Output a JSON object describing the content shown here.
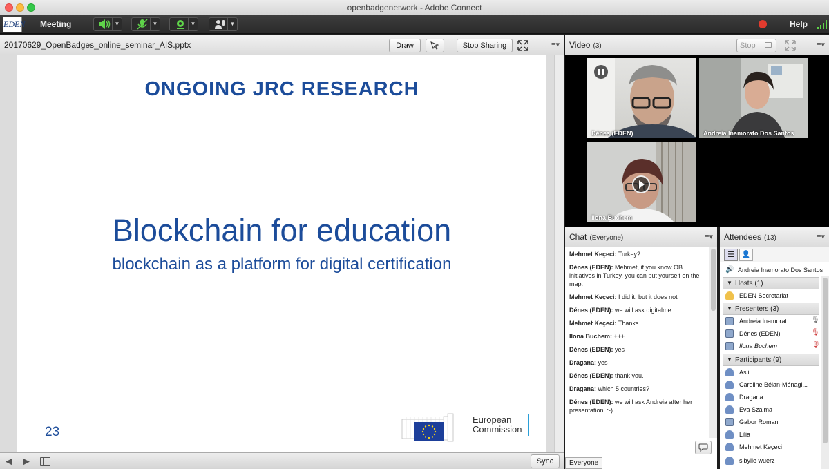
{
  "window": {
    "title": "openbadgenetwork - Adobe Connect"
  },
  "menubar": {
    "logo_text": "EDEN",
    "meeting_label": "Meeting",
    "help_label": "Help"
  },
  "share_pod": {
    "filename": "20170629_OpenBadges_online_seminar_AIS.pptx",
    "draw_label": "Draw",
    "stop_sharing_label": "Stop Sharing",
    "sync_label": "Sync"
  },
  "slide": {
    "heading": "ONGOING JRC RESEARCH",
    "title": "Blockchain for education",
    "subtitle": "blockchain as a platform for digital certification",
    "page_number": "23",
    "logo_line1": "European",
    "logo_line2": "Commission"
  },
  "video_pod": {
    "title": "Video",
    "count": "(3)",
    "stop_label": "Stop",
    "tiles": [
      {
        "name": "Dénes (EDEN)"
      },
      {
        "name": "Andreia Inamorato Dos Santos"
      },
      {
        "name": "Ilona Buchem"
      }
    ]
  },
  "chat_pod": {
    "title": "Chat",
    "scope": "(Everyone)",
    "recipient_label": "Everyone",
    "messages": [
      {
        "sender": "Mehmet Keçeci:",
        "text": " Turkey?"
      },
      {
        "sender": "Dénes (EDEN):",
        "text": " Mehmet, if you know OB initiatives in Turkey, you can put yourself on the map."
      },
      {
        "sender": "Mehmet Keçeci:",
        "text": " I did it, but it does not"
      },
      {
        "sender": "Dénes (EDEN):",
        "text": " we will ask digitalme..."
      },
      {
        "sender": "Mehmet Keçeci:",
        "text": " Thanks"
      },
      {
        "sender": "Ilona Buchem:",
        "text": " +++"
      },
      {
        "sender": "Dénes (EDEN):",
        "text": " yes"
      },
      {
        "sender": "Dragana:",
        "text": " yes"
      },
      {
        "sender": "Dénes (EDEN):",
        "text": " thank you."
      },
      {
        "sender": "Dragana:",
        "text": " which 5 countries?"
      },
      {
        "sender": "Dénes (EDEN):",
        "text": " we will ask Andreia after her presentation. :-)"
      }
    ]
  },
  "attendees_pod": {
    "title": "Attendees",
    "count": "(13)",
    "active_speaker": "Andreia Inamorato Dos Santos",
    "hosts_label": "Hosts (1)",
    "hosts": [
      "EDEN Secretariat"
    ],
    "presenters_label": "Presenters (3)",
    "presenters": [
      "Andreia Inamorat...",
      "Dénes (EDEN)",
      "Ilona Buchem"
    ],
    "participants_label": "Participants (9)",
    "participants": [
      "Asli",
      "Caroline Bélan-Ménagi...",
      "Dragana",
      "Eva Szalma",
      "Gabor Roman",
      "Lilia",
      "Mehmet Keçeci",
      "sibylle wuerz"
    ]
  },
  "colors": {
    "slide_blue": "#1c4c9a",
    "accent_green": "#5fd34a",
    "record_red": "#e23b2e"
  }
}
